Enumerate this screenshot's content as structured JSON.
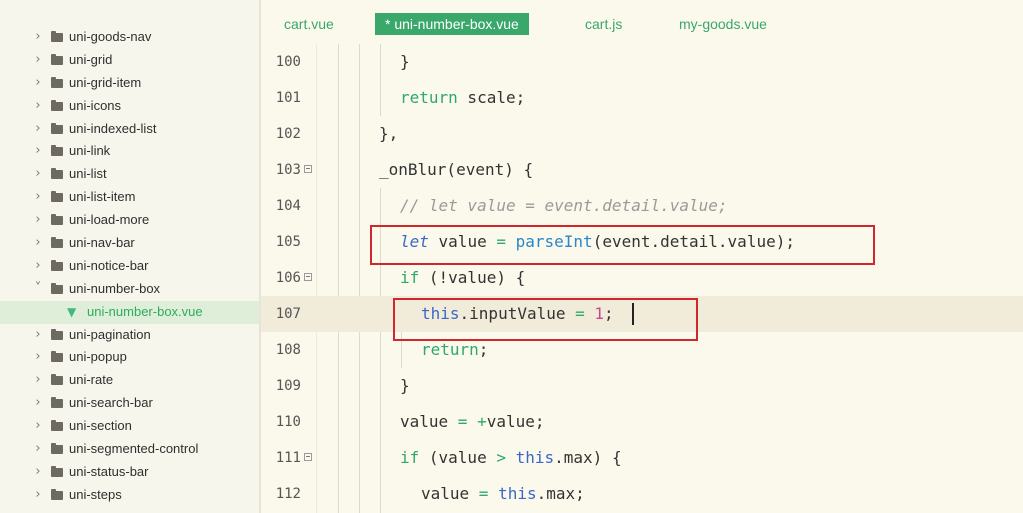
{
  "sidebar": {
    "items": [
      {
        "label": "uni-goods-nav",
        "type": "folder",
        "expanded": false
      },
      {
        "label": "uni-grid",
        "type": "folder",
        "expanded": false
      },
      {
        "label": "uni-grid-item",
        "type": "folder",
        "expanded": false
      },
      {
        "label": "uni-icons",
        "type": "folder",
        "expanded": false
      },
      {
        "label": "uni-indexed-list",
        "type": "folder",
        "expanded": false
      },
      {
        "label": "uni-link",
        "type": "folder",
        "expanded": false
      },
      {
        "label": "uni-list",
        "type": "folder",
        "expanded": false
      },
      {
        "label": "uni-list-item",
        "type": "folder",
        "expanded": false
      },
      {
        "label": "uni-load-more",
        "type": "folder",
        "expanded": false
      },
      {
        "label": "uni-nav-bar",
        "type": "folder",
        "expanded": false
      },
      {
        "label": "uni-notice-bar",
        "type": "folder",
        "expanded": false
      },
      {
        "label": "uni-number-box",
        "type": "folder",
        "expanded": true
      },
      {
        "label": "uni-number-box.vue",
        "type": "file",
        "selected": true
      },
      {
        "label": "uni-pagination",
        "type": "folder",
        "expanded": false
      },
      {
        "label": "uni-popup",
        "type": "folder",
        "expanded": false
      },
      {
        "label": "uni-rate",
        "type": "folder",
        "expanded": false
      },
      {
        "label": "uni-search-bar",
        "type": "folder",
        "expanded": false
      },
      {
        "label": "uni-section",
        "type": "folder",
        "expanded": false
      },
      {
        "label": "uni-segmented-control",
        "type": "folder",
        "expanded": false
      },
      {
        "label": "uni-status-bar",
        "type": "folder",
        "expanded": false
      },
      {
        "label": "uni-steps",
        "type": "folder",
        "expanded": false
      }
    ]
  },
  "tabs": [
    {
      "label": "cart.vue",
      "active": false
    },
    {
      "label": "* uni-number-box.vue",
      "active": true
    },
    {
      "label": "cart.js",
      "active": false
    },
    {
      "label": "my-goods.vue",
      "active": false
    }
  ],
  "editor": {
    "current_line": "107",
    "lines": [
      {
        "number": "100",
        "text": "}"
      },
      {
        "number": "101",
        "text": "return scale;"
      },
      {
        "number": "102",
        "text": "},"
      },
      {
        "number": "103",
        "text": "_onBlur(event) {"
      },
      {
        "number": "104",
        "text": "// let value = event.detail.value;"
      },
      {
        "number": "105",
        "text": "let value = parseInt(event.detail.value);"
      },
      {
        "number": "106",
        "text": "if (!value) {"
      },
      {
        "number": "107",
        "text": "this.inputValue = 1;"
      },
      {
        "number": "108",
        "text": "return;"
      },
      {
        "number": "109",
        "text": "}"
      },
      {
        "number": "110",
        "text": "value = +value;"
      },
      {
        "number": "111",
        "text": "if (value > this.max) {"
      },
      {
        "number": "112",
        "text": "value = this.max;"
      }
    ]
  },
  "colors": {
    "accent": "#3aa76b",
    "highlight_box": "#d0262e",
    "current_line_bg": "#f1ebda"
  }
}
